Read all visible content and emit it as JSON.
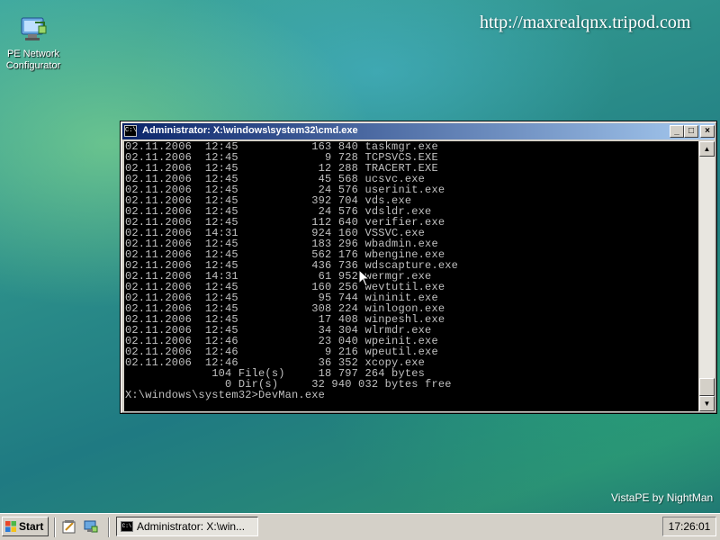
{
  "desktop": {
    "icon_label": "PE Network Configurator",
    "icon_name": "network-configurator-icon",
    "watermark": "http://maxrealqnx.tripod.com",
    "brand": "VistaPE by NightMan"
  },
  "window": {
    "title": "Administrator: X:\\windows\\system32\\cmd.exe",
    "minimize_label": "_",
    "maximize_label": "□",
    "close_label": "×",
    "icon_text": "C:\\"
  },
  "console": {
    "lines": [
      "02.11.2006  12:45           163 840 taskmgr.exe",
      "02.11.2006  12:45             9 728 TCPSVCS.EXE",
      "02.11.2006  12:45            12 288 TRACERT.EXE",
      "02.11.2006  12:45            45 568 ucsvc.exe",
      "02.11.2006  12:45            24 576 userinit.exe",
      "02.11.2006  12:45           392 704 vds.exe",
      "02.11.2006  12:45            24 576 vdsldr.exe",
      "02.11.2006  12:45           112 640 verifier.exe",
      "02.11.2006  14:31           924 160 VSSVC.exe",
      "02.11.2006  12:45           183 296 wbadmin.exe",
      "02.11.2006  12:45           562 176 wbengine.exe",
      "02.11.2006  12:45           436 736 wdscapture.exe",
      "02.11.2006  14:31            61 952 wermgr.exe",
      "02.11.2006  12:45           160 256 wevtutil.exe",
      "02.11.2006  12:45            95 744 wininit.exe",
      "02.11.2006  12:45           308 224 winlogon.exe",
      "02.11.2006  12:45            17 408 winpeshl.exe",
      "02.11.2006  12:45            34 304 wlrmdr.exe",
      "02.11.2006  12:46            23 040 wpeinit.exe",
      "02.11.2006  12:46             9 216 wpeutil.exe",
      "02.11.2006  12:46            36 352 xcopy.exe",
      "             104 File(s)     18 797 264 bytes",
      "               0 Dir(s)     32 940 032 bytes free",
      ""
    ],
    "prompt": "X:\\windows\\system32>DevMan.exe"
  },
  "taskbar": {
    "start_label": "Start",
    "task_label": "Administrator: X:\\win...",
    "clock": "17:26:01"
  }
}
